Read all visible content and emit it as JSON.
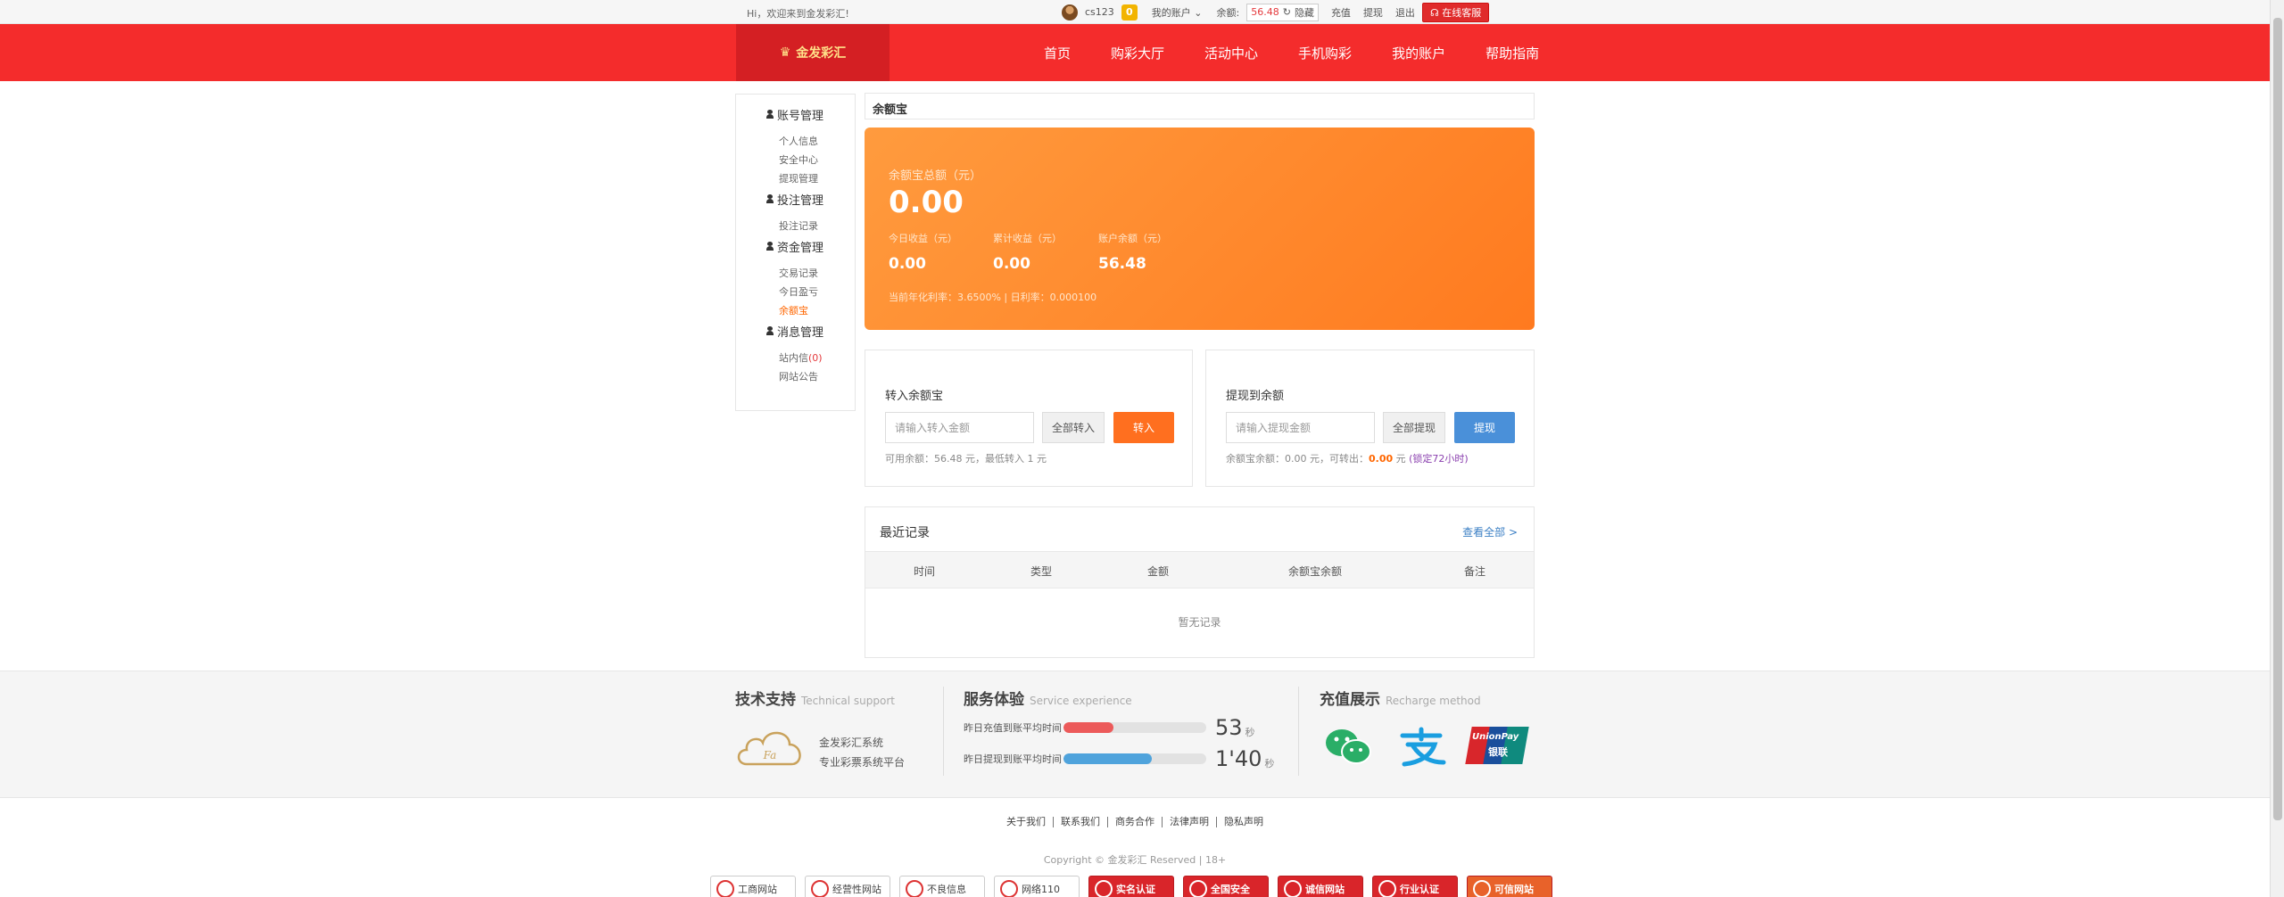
{
  "topbar": {
    "greeting": "Hi，欢迎来到金发彩汇!",
    "username": "cs123",
    "level": "0",
    "my_account": "我的账户",
    "balance_label": "余额:",
    "balance_value": "56.48",
    "hide_label": "隐藏",
    "recharge": "充值",
    "withdraw": "提现",
    "logout": "退出",
    "online_service": "在线客服"
  },
  "nav": {
    "logo_text": "金发彩汇",
    "items": [
      "首页",
      "购彩大厅",
      "活动中心",
      "手机购彩",
      "我的账户",
      "帮助指南"
    ]
  },
  "sidebar": {
    "groups": [
      {
        "title": "账号管理",
        "items": [
          "个人信息",
          "安全中心",
          "提现管理"
        ]
      },
      {
        "title": "投注管理",
        "items": [
          "投注记录"
        ]
      },
      {
        "title": "资金管理",
        "items": [
          "交易记录",
          "今日盈亏",
          "余额宝"
        ]
      },
      {
        "title": "消息管理",
        "items": [
          "站内信",
          "网站公告"
        ]
      }
    ],
    "inbox_count": "(0)"
  },
  "page_title": "余额宝",
  "hero": {
    "total_label": "余额宝总额（元）",
    "total_value": "0.00",
    "today_label": "今日收益（元）",
    "today_value": "0.00",
    "cumulative_label": "累计收益（元）",
    "cumulative_value": "0.00",
    "account_label": "账户余额（元）",
    "account_value": "56.48",
    "rate_text": "当前年化利率：3.6500% | 日利率：0.000100"
  },
  "transfer_in": {
    "title": "转入余额宝",
    "placeholder": "请输入转入金额",
    "all_button": "全部转入",
    "go_button": "转入",
    "hint": "可用余额：56.48 元，最低转入 1 元"
  },
  "withdraw_to": {
    "title": "提现到余额",
    "placeholder": "请输入提现金额",
    "all_button": "全部提现",
    "go_button": "提现",
    "hint_prefix": "余额宝余额：0.00 元，可转出：",
    "hint_amount": "0.00",
    "hint_mid": " 元 ",
    "hint_lock": "(锁定72小时)"
  },
  "records": {
    "title": "最近记录",
    "view_all": "查看全部 >",
    "columns": [
      "时间",
      "类型",
      "金额",
      "余额宝余额",
      "备注"
    ],
    "empty_text": "暂无记录"
  },
  "footer": {
    "tech_title": "技术支持",
    "tech_sub": "Technical support",
    "tech_line1": "金发彩汇系统",
    "tech_line2": "专业彩票系统平台",
    "service_title": "服务体验",
    "service_sub": "Service experience",
    "recharge_label": "昨日充值到账平均时间",
    "recharge_value": "53",
    "recharge_unit": "秒",
    "recharge_progress": 0.35,
    "withdraw_label": "昨日提现到账平均时间",
    "withdraw_value": "1'40",
    "withdraw_unit": "秒",
    "withdraw_progress": 0.62,
    "pay_title": "充值展示",
    "pay_sub": "Recharge method",
    "unionpay_text": "UnionPay",
    "unionpay_cn": "银联",
    "links": [
      "关于我们",
      "联系我们",
      "商务合作",
      "法律声明",
      "隐私声明"
    ],
    "copyright": "Copyright © 金发彩汇 Reserved | 18+",
    "badges": [
      "工商网站",
      "经营性网站",
      "不良信息",
      "网络110",
      "实名认证",
      "全国安全",
      "诚信网站",
      "行业认证",
      "可信网站"
    ]
  },
  "colors": {
    "nav_red": "#f42c2c",
    "orange": "#ff7a1f",
    "blue_button": "#4a90d9",
    "recharge_bar": "#ec5a5a",
    "withdraw_bar": "#4fa3dc"
  }
}
